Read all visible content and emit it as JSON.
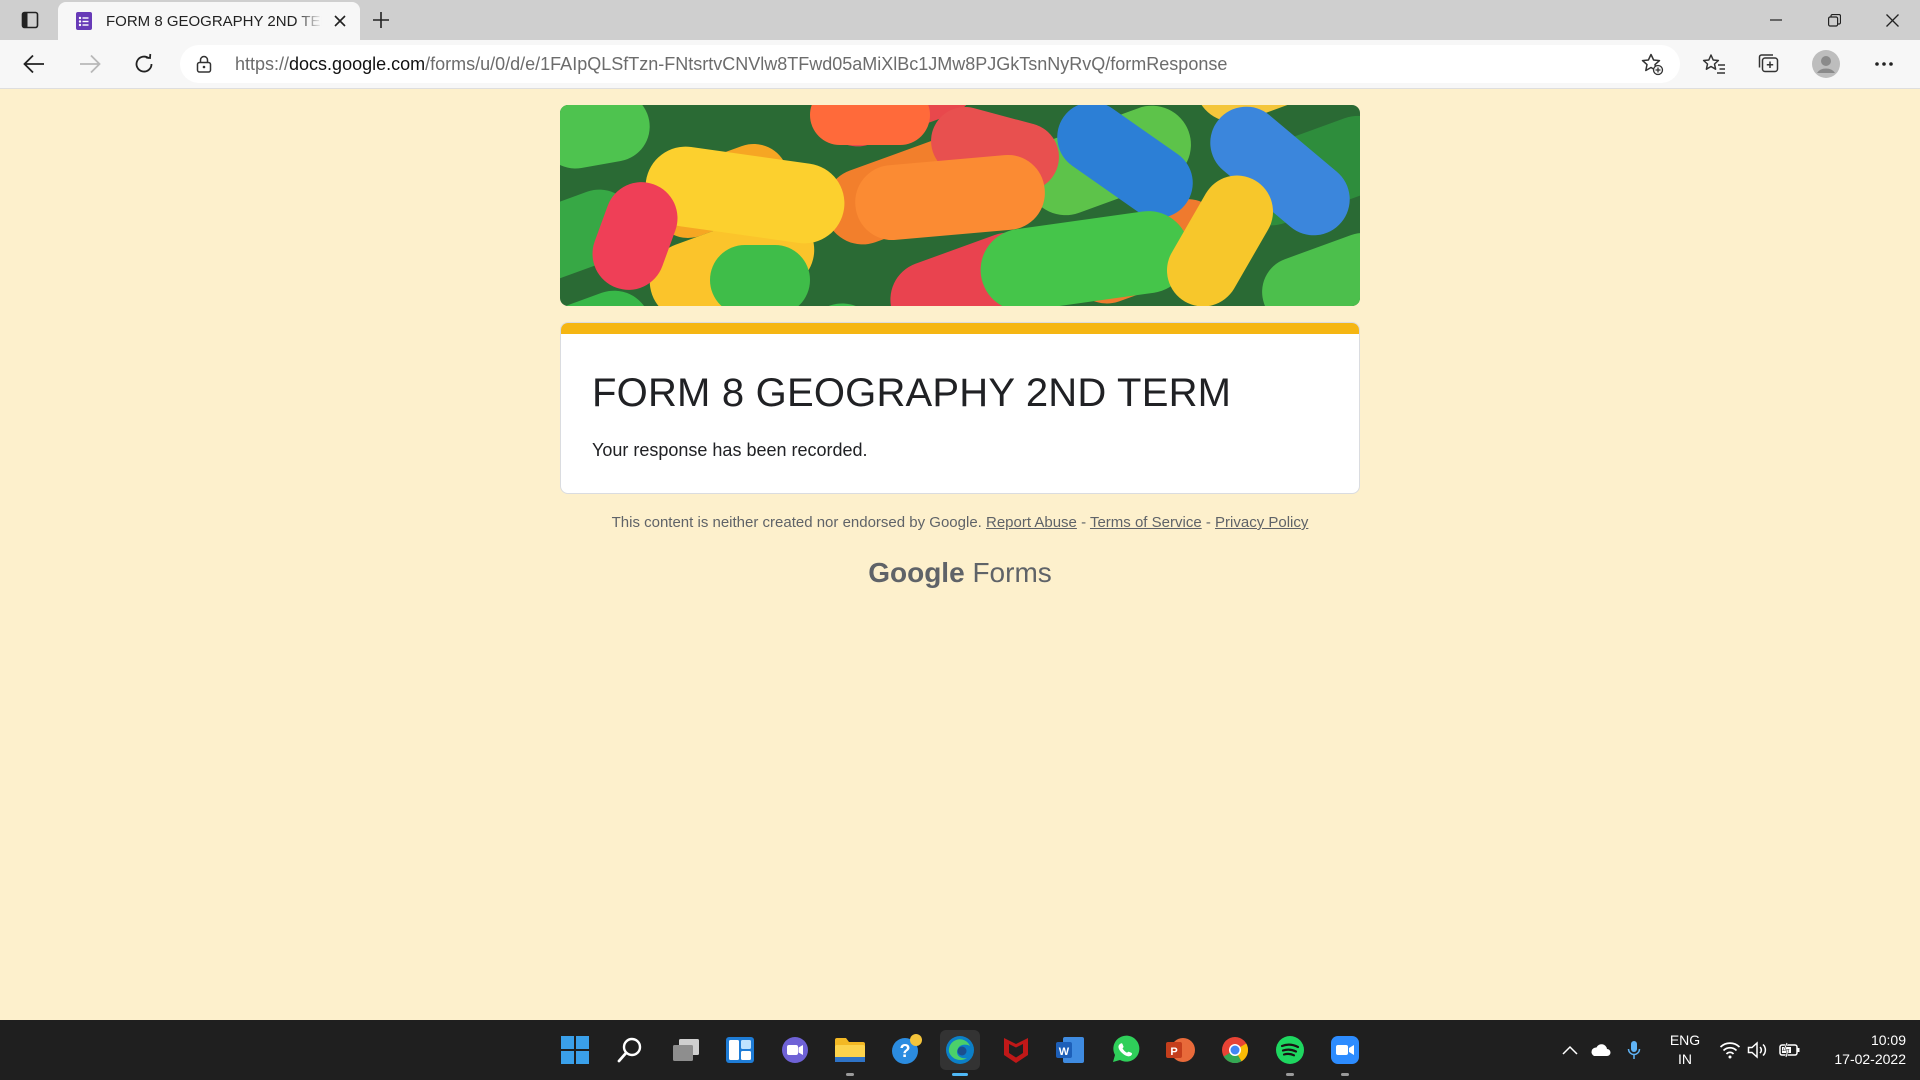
{
  "browser": {
    "tab": {
      "title": "FORM 8 GEOGRAPHY 2ND TERM"
    },
    "address": {
      "prefix": "https://",
      "host": "docs.google.com",
      "path": "/forms/u/0/d/e/1FAIpQLSfTzn-FNtsrtvCNVlw8TFwd05aMiXlBc1JMw8PJGkTsnNyRvQ/formResponse"
    }
  },
  "form": {
    "title": "FORM 8 GEOGRAPHY 2ND TERM",
    "confirmation": "Your response has been recorded.",
    "accent_color": "#f5b613",
    "background_color": "#fdf0cc"
  },
  "footer": {
    "disclaimer": "This content is neither created nor endorsed by Google.",
    "report_abuse": "Report Abuse",
    "terms": "Terms of Service",
    "privacy": "Privacy Policy",
    "separator": " - ",
    "logo_google": "Google",
    "logo_forms": "Forms"
  },
  "taskbar": {
    "apps": [
      "start",
      "search",
      "task-view",
      "widgets",
      "teams-chat",
      "file-explorer",
      "get-help",
      "edge",
      "mcafee",
      "word",
      "whatsapp",
      "powerpoint",
      "chrome",
      "spotify",
      "zoom"
    ],
    "language": "ENG",
    "region": "IN",
    "time": "10:09",
    "date": "17-02-2022"
  }
}
